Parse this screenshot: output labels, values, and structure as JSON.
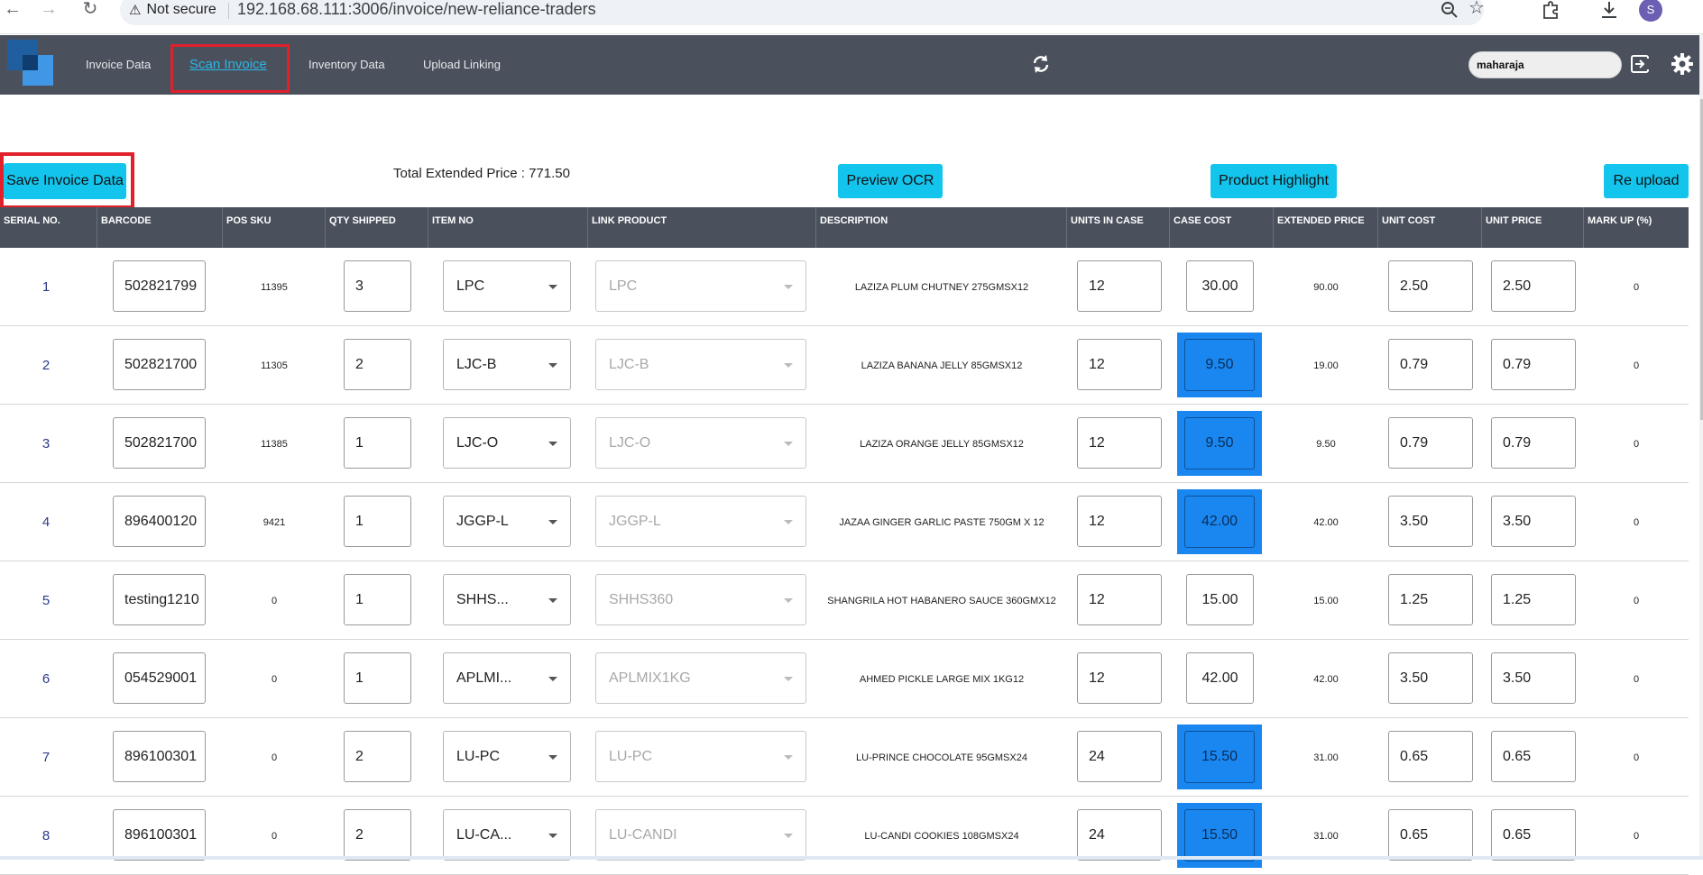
{
  "browser": {
    "security_label": "Not secure",
    "url": "192.168.68.111:3006/invoice/new-reliance-traders",
    "profile_initial": "S"
  },
  "nav": {
    "items": [
      {
        "label": "Invoice Data"
      },
      {
        "label": "Scan Invoice"
      },
      {
        "label": "Inventory Data"
      },
      {
        "label": "Upload Linking"
      }
    ],
    "active": "Scan Invoice"
  },
  "user": {
    "store_value": "maharaja"
  },
  "toolbar": {
    "save_label": "Save Invoice Data",
    "total_label": "Total Extended Price : 771.50",
    "preview_label": "Preview OCR",
    "highlight_label": "Product Highlight",
    "reupload_label": "Re upload"
  },
  "colors": {
    "header": "#4a515d",
    "accent_button": "#13c4ec",
    "highlight_cell": "#1a87f0",
    "annotation": "#e0202a"
  },
  "table": {
    "columns": [
      "SERIAL NO.",
      "BARCODE",
      "POS SKU",
      "QTY SHIPPED",
      "ITEM NO",
      "LINK PRODUCT",
      "DESCRIPTION",
      "UNITS IN CASE",
      "CASE COST",
      "EXTENDED PRICE",
      "UNIT COST",
      "UNIT PRICE",
      "MARK UP (%)"
    ],
    "rows": [
      {
        "serial": "1",
        "barcode": "502821799",
        "pos_sku": "11395",
        "qty": "3",
        "item_no": "LPC",
        "link": "LPC",
        "description": "LAZIZA PLUM CHUTNEY 275GMSX12",
        "units": "12",
        "case_cost": "30.00",
        "highlighted": false,
        "extended": "90.00",
        "unit_cost": "2.50",
        "unit_price": "2.50",
        "markup": "0"
      },
      {
        "serial": "2",
        "barcode": "502821700",
        "pos_sku": "11305",
        "qty": "2",
        "item_no": "LJC-B",
        "link": "LJC-B",
        "description": "LAZIZA BANANA JELLY 85GMSX12",
        "units": "12",
        "case_cost": "9.50",
        "highlighted": true,
        "extended": "19.00",
        "unit_cost": "0.79",
        "unit_price": "0.79",
        "markup": "0"
      },
      {
        "serial": "3",
        "barcode": "502821700",
        "pos_sku": "11385",
        "qty": "1",
        "item_no": "LJC-O",
        "link": "LJC-O",
        "description": "LAZIZA ORANGE JELLY 85GMSX12",
        "units": "12",
        "case_cost": "9.50",
        "highlighted": true,
        "extended": "9.50",
        "unit_cost": "0.79",
        "unit_price": "0.79",
        "markup": "0"
      },
      {
        "serial": "4",
        "barcode": "896400120",
        "pos_sku": "9421",
        "qty": "1",
        "item_no": "JGGP-L",
        "link": "JGGP-L",
        "description": "JAZAA GINGER GARLIC PASTE 750GM X 12",
        "units": "12",
        "case_cost": "42.00",
        "highlighted": true,
        "extended": "42.00",
        "unit_cost": "3.50",
        "unit_price": "3.50",
        "markup": "0"
      },
      {
        "serial": "5",
        "barcode": "testing1210",
        "pos_sku": "0",
        "qty": "1",
        "item_no": "SHHS...",
        "link": "SHHS360",
        "description": "SHANGRILA HOT HABANERO SAUCE 360GMX12",
        "units": "12",
        "case_cost": "15.00",
        "highlighted": false,
        "extended": "15.00",
        "unit_cost": "1.25",
        "unit_price": "1.25",
        "markup": "0"
      },
      {
        "serial": "6",
        "barcode": "054529001",
        "pos_sku": "0",
        "qty": "1",
        "item_no": "APLMI...",
        "link": "APLMIX1KG",
        "description": "AHMED PICKLE LARGE MIX 1KG12",
        "units": "12",
        "case_cost": "42.00",
        "highlighted": false,
        "extended": "42.00",
        "unit_cost": "3.50",
        "unit_price": "3.50",
        "markup": "0"
      },
      {
        "serial": "7",
        "barcode": "896100301",
        "pos_sku": "0",
        "qty": "2",
        "item_no": "LU-PC",
        "link": "LU-PC",
        "description": "LU-PRINCE CHOCOLATE 95GMSX24",
        "units": "24",
        "case_cost": "15.50",
        "highlighted": true,
        "extended": "31.00",
        "unit_cost": "0.65",
        "unit_price": "0.65",
        "markup": "0"
      },
      {
        "serial": "8",
        "barcode": "896100301",
        "pos_sku": "0",
        "qty": "2",
        "item_no": "LU-CA...",
        "link": "LU-CANDI",
        "description": "LU-CANDI COOKIES 108GMSX24",
        "units": "24",
        "case_cost": "15.50",
        "highlighted": true,
        "extended": "31.00",
        "unit_cost": "0.65",
        "unit_price": "0.65",
        "markup": "0"
      }
    ]
  }
}
